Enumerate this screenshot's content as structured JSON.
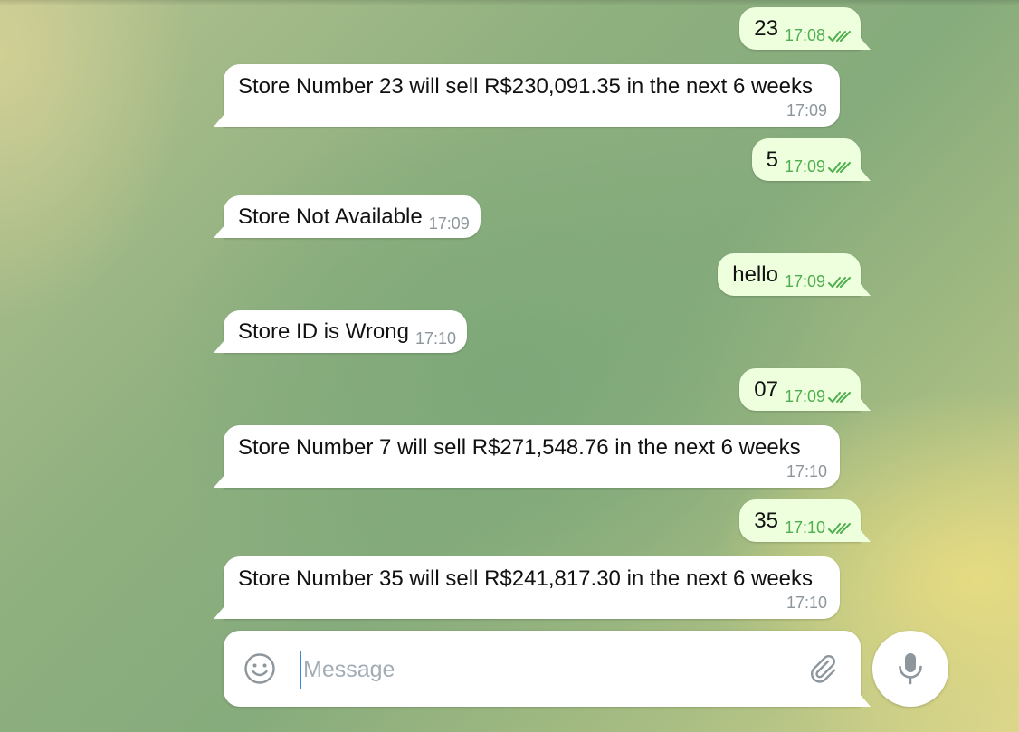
{
  "chat": {
    "messages": [
      {
        "direction": "out",
        "text": "23",
        "time": "17:08",
        "status": "read"
      },
      {
        "direction": "in",
        "text": "Store Number 23 will sell R$230,091.35 in the next 6 weeks",
        "time": "17:09"
      },
      {
        "direction": "out",
        "text": "5",
        "time": "17:09",
        "status": "read"
      },
      {
        "direction": "in",
        "text": "Store Not Available",
        "time": "17:09"
      },
      {
        "direction": "out",
        "text": "hello",
        "time": "17:09",
        "status": "read"
      },
      {
        "direction": "in",
        "text": "Store ID is Wrong",
        "time": "17:10"
      },
      {
        "direction": "out",
        "text": "07",
        "time": "17:09",
        "status": "read"
      },
      {
        "direction": "in",
        "text": "Store Number 7 will sell R$271,548.76 in the next 6 weeks",
        "time": "17:10"
      },
      {
        "direction": "out",
        "text": "35",
        "time": "17:10",
        "status": "read"
      },
      {
        "direction": "in",
        "text": "Store Number 35 will sell R$241,817.30 in the next 6 weeks",
        "time": "17:10"
      }
    ]
  },
  "composer": {
    "placeholder": "Message",
    "value": "",
    "emoji_icon": "smiley-icon",
    "attach_icon": "paperclip-icon",
    "mic_icon": "microphone-icon"
  },
  "colors": {
    "incoming_bubble": "#ffffff",
    "outgoing_bubble": "#eeffde",
    "outgoing_meta": "#4fae4e",
    "meta_gray": "#8d969c",
    "caret": "#3a8bd6"
  }
}
